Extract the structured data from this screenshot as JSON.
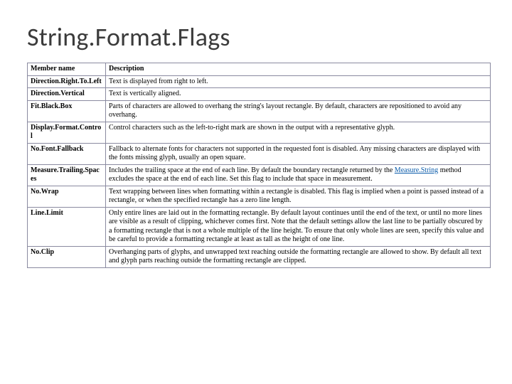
{
  "title": "String.Format.Flags",
  "headers": {
    "member": "Member name",
    "description": "Description"
  },
  "rows": {
    "r0": {
      "name": "Direction.Right.To.Left",
      "desc": "Text is displayed from right to left."
    },
    "r1": {
      "name": "Direction.Vertical",
      "desc": "Text is vertically aligned."
    },
    "r2": {
      "name": "Fit.Black.Box",
      "desc": "Parts of characters are allowed to overhang the string's layout rectangle. By default, characters are repositioned to avoid any overhang."
    },
    "r3": {
      "name": "Display.Format.Control",
      "desc": "Control characters such as the left-to-right mark are shown in the output with a representative glyph."
    },
    "r4": {
      "name": "No.Font.Fallback",
      "desc": "Fallback to alternate fonts for characters not supported in the requested font is disabled. Any missing characters are displayed with the fonts missing glyph, usually an open square."
    },
    "r5": {
      "name": "Measure.Trailing.Spaces",
      "desc_pre": "Includes the trailing space at the end of each line. By default the boundary rectangle returned by the ",
      "link_text": "Measure.String",
      "desc_post": " method excludes the space at the end of each line. Set this flag to include that space in measurement."
    },
    "r6": {
      "name": "No.Wrap",
      "desc": "Text wrapping between lines when formatting within a rectangle is disabled. This flag is implied when a point is passed instead of a rectangle, or when the specified rectangle has a zero line length."
    },
    "r7": {
      "name": "Line.Limit",
      "desc": "Only entire lines are laid out in the formatting rectangle. By default layout continues until the end of the text, or until no more lines are visible as a result of clipping, whichever comes first. Note that the default settings allow the last line to be partially obscured by a formatting rectangle that is not a whole multiple of the line height. To ensure that only whole lines are seen, specify this value and be careful to provide a formatting rectangle at least as tall as the height of one line."
    },
    "r8": {
      "name": "No.Clip",
      "desc": "Overhanging parts of glyphs, and unwrapped text reaching outside the formatting rectangle are allowed to show. By default all text and glyph parts reaching outside the formatting rectangle are clipped."
    }
  }
}
